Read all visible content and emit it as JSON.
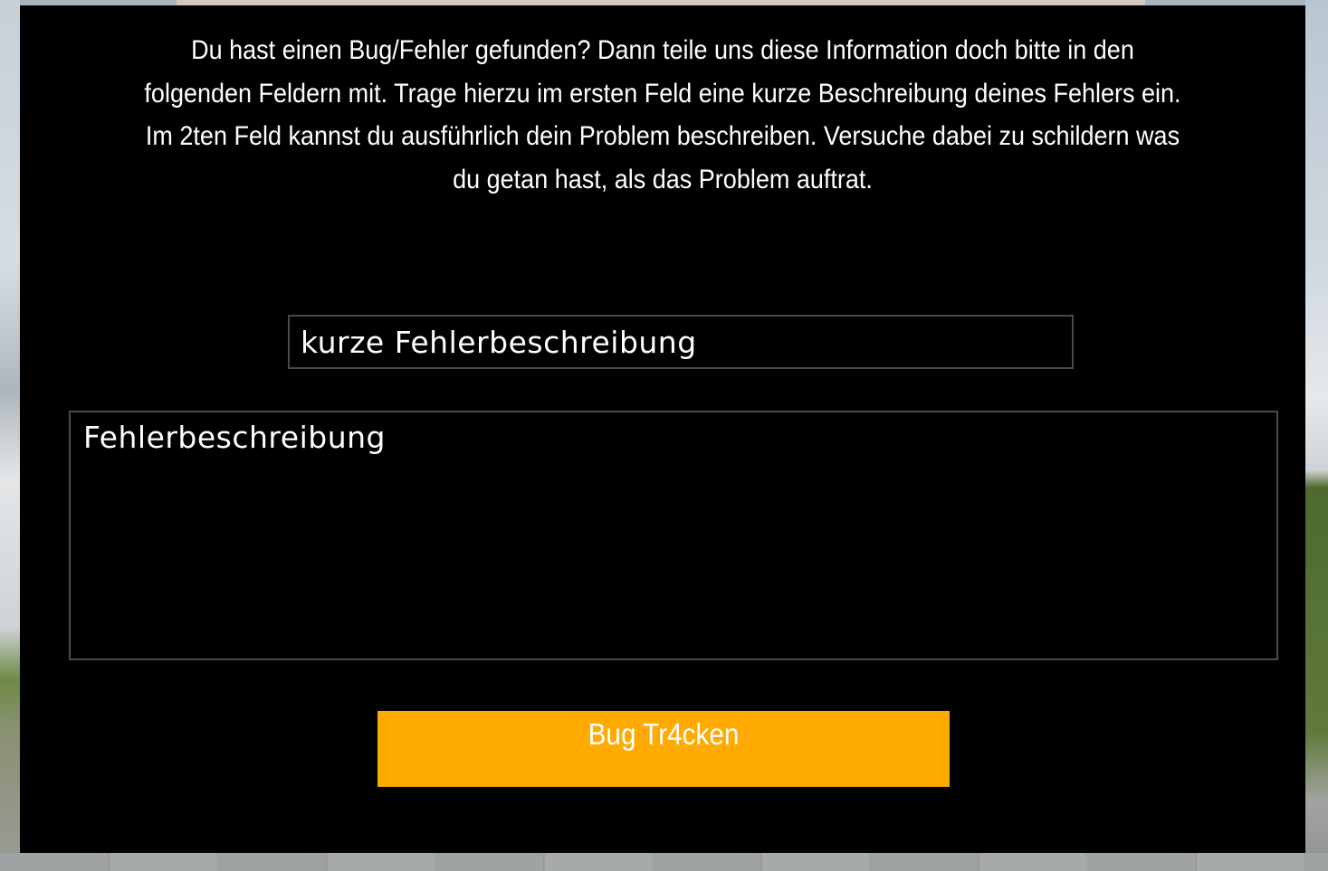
{
  "dialog": {
    "intro_lines": [
      "Du hast einen Bug/Fehler gefunden? Dann teile uns diese Information doch bitte in den",
      "folgenden Feldern mit. Trage hierzu im ersten Feld eine kurze Beschreibung deines Fehlers ein.",
      "Im 2ten Feld kannst du ausführlich dein Problem beschreiben. Versuche dabei zu schildern was",
      "du getan hast, als das Problem auftrat."
    ],
    "short_description": {
      "placeholder": "kurze Fehlerbeschreibung",
      "value": ""
    },
    "long_description": {
      "placeholder": "Fehlerbeschreibung",
      "value": ""
    },
    "submit_label": "Bug Tr4cken"
  },
  "colors": {
    "panel_background": "#000000",
    "accent": "#ffaa00",
    "text": "#ffffff",
    "field_border": "#4a4a4a"
  }
}
